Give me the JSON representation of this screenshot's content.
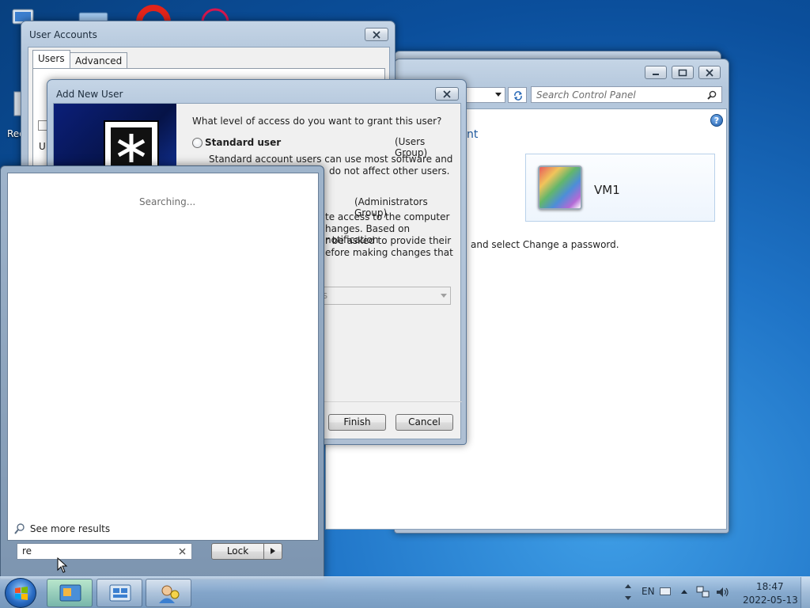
{
  "desktop": {
    "partial_icon_label": "Rec"
  },
  "control_panel": {
    "search_placeholder": "Search Control Panel",
    "partial_heading_fragment": "nt",
    "account_name": "VM1",
    "change_password_text": "and select Change a password.",
    "help_symbol": "?"
  },
  "user_accounts": {
    "title": "User Accounts",
    "tabs": [
      "Users",
      "Advanced"
    ],
    "partial_letter": "U"
  },
  "add_new_user": {
    "title": "Add New User",
    "question": "What level of access do you want to grant this user?",
    "standard_label": "Standard user",
    "standard_group": "(Users Group)",
    "standard_desc_line1": "Standard account users can use most software and",
    "standard_desc_line2": "do not affect other users.",
    "admin_group": "(Administrators Group)",
    "admin_desc_line1": "te access to the computer",
    "admin_desc_line2": "hanges. Based on notification",
    "admin_desc_line3": "r be asked to provide their",
    "admin_desc_line4": "efore making changes that",
    "other_value": "rs",
    "finish_label": "Finish",
    "cancel_label": "Cancel"
  },
  "start_menu": {
    "searching_text": "Searching...",
    "see_more_results": "See more results",
    "search_value": "re",
    "lock_label": "Lock"
  },
  "taskbar": {
    "language": "EN",
    "time": "18:47",
    "date": "2022-05-13"
  }
}
